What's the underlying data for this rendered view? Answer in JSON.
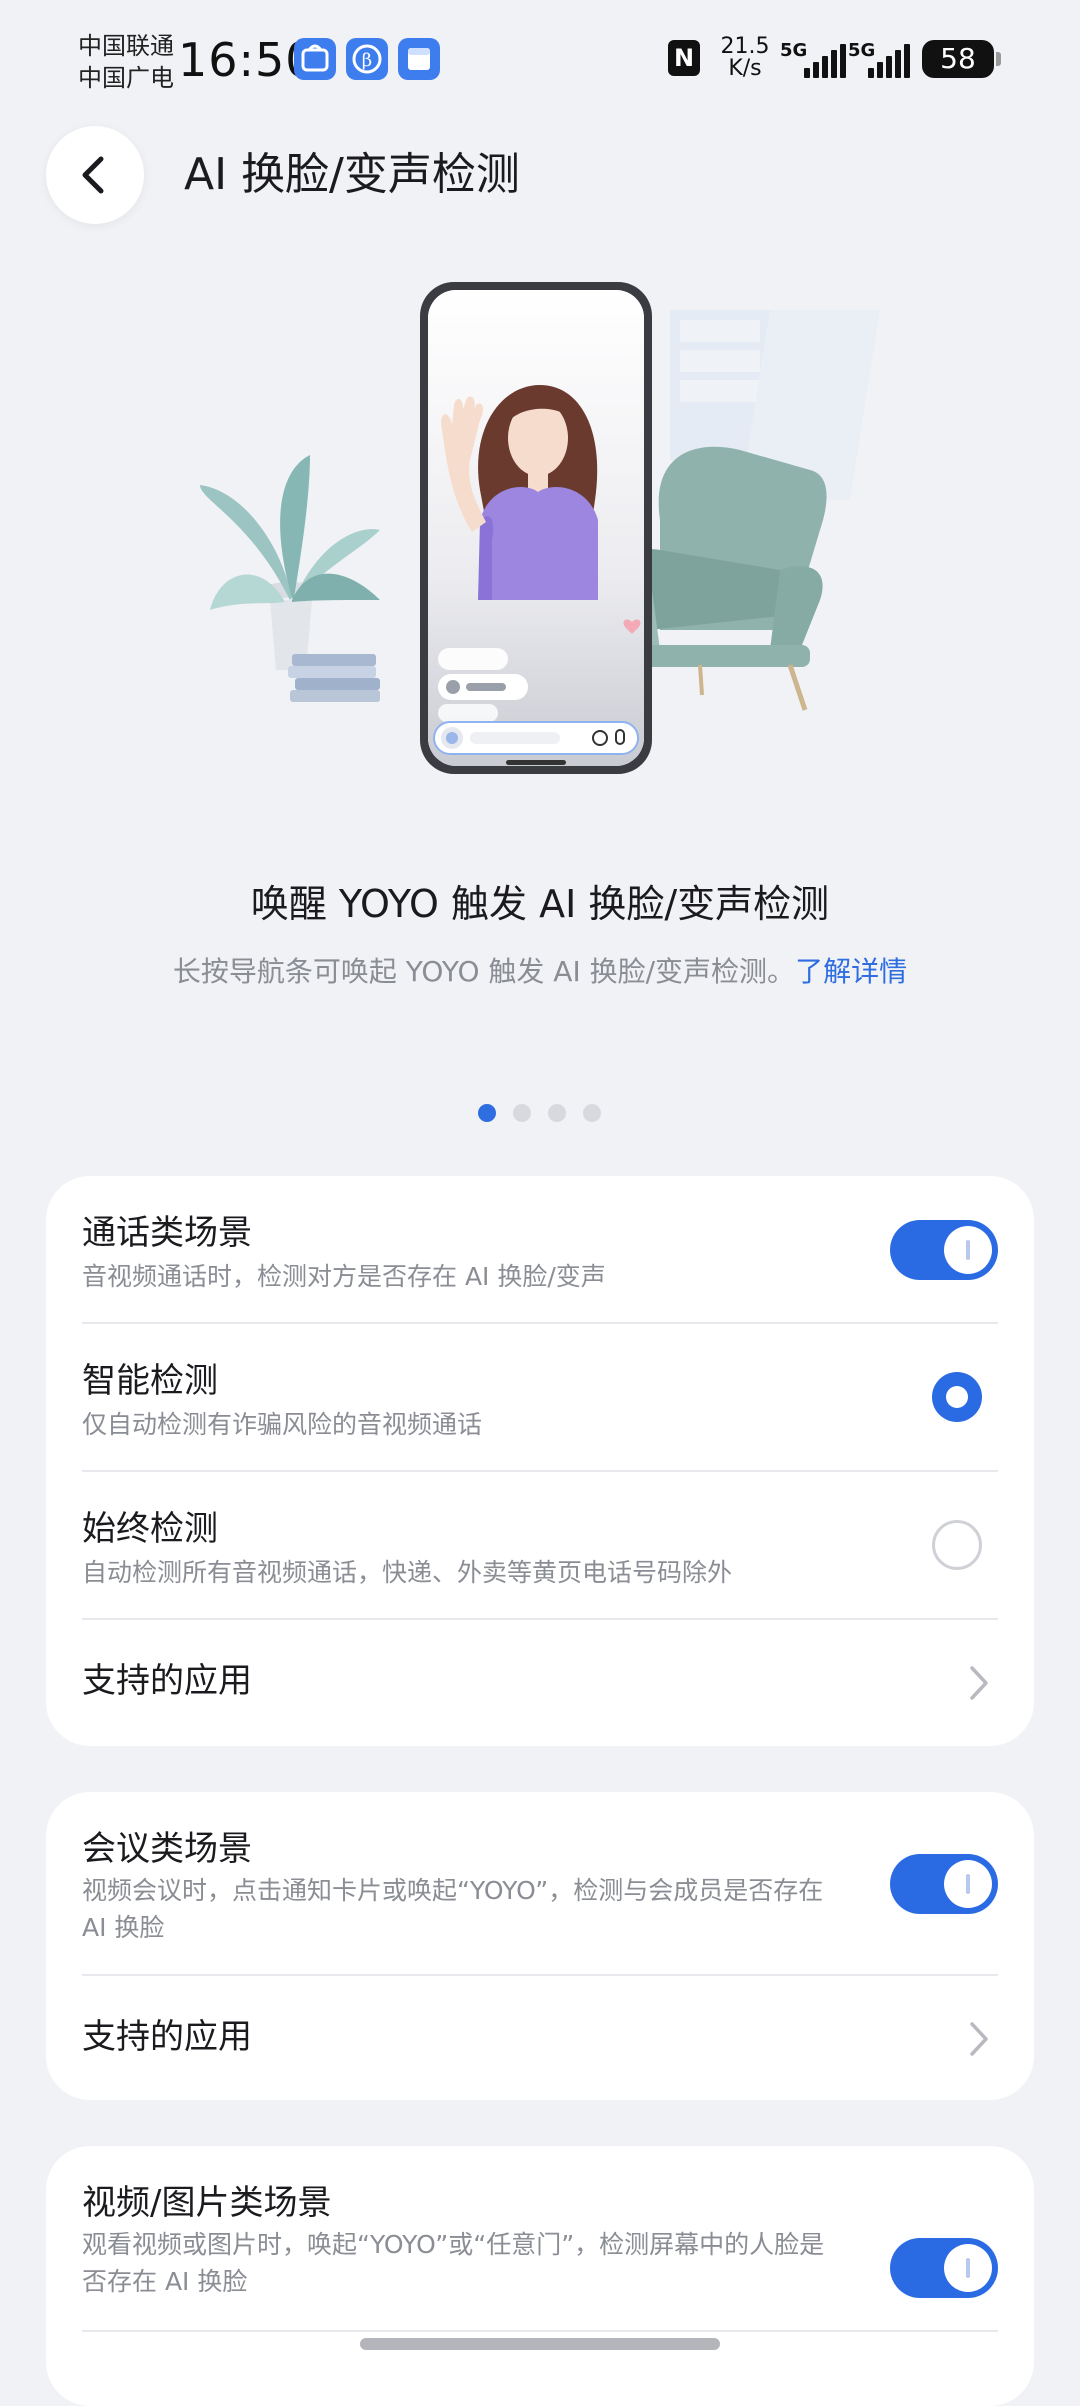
{
  "status_bar": {
    "carrier_1": "中国联通",
    "carrier_2": "中国广电",
    "time": "16:50",
    "net_speed_value": "21.5",
    "net_speed_unit": "K/s",
    "signal_1": "5G",
    "signal_2": "5G",
    "battery": "58",
    "app_icons": [
      "app-market-icon",
      "beta-icon",
      "file-icon"
    ]
  },
  "header": {
    "back_icon": "chevron-left-icon",
    "title": "AI 换脸/变声检测"
  },
  "intro": {
    "title": "唤醒 YOYO 触发 AI 换脸/变声检测",
    "description": "长按导航条可唤起 YOYO 触发 AI 换脸/变声检测。",
    "link": "了解详情",
    "pager": {
      "total": 4,
      "active": 1
    }
  },
  "sections": {
    "call": {
      "title": "通话类场景",
      "subtitle": "音视频通话时，检测对方是否存在 AI 换脸/变声",
      "toggle_on": true,
      "options": [
        {
          "title": "智能检测",
          "subtitle": "仅自动检测有诈骗风险的音视频通话",
          "selected": true
        },
        {
          "title": "始终检测",
          "subtitle": "自动检测所有音视频通话，快递、外卖等黄页电话号码除外",
          "selected": false
        }
      ],
      "supported_apps": "支持的应用"
    },
    "meeting": {
      "title": "会议类场景",
      "subtitle_line1": "视频会议时，点击通知卡片或唤起“YOYO”，检测与会成员是否存在",
      "subtitle_line2": "AI 换脸",
      "toggle_on": true,
      "supported_apps": "支持的应用"
    },
    "media": {
      "title": "视频/图片类场景",
      "subtitle_line1": "观看视频或图片时，唤起“YOYO”或“任意门”，检测屏幕中的人脸是",
      "subtitle_line2": "否存在 AI 换脸",
      "toggle_on": true
    }
  },
  "colors": {
    "accent": "#2a6be3",
    "background": "#f1f2f6",
    "card": "#ffffff",
    "secondary_text": "#8a8d94"
  }
}
